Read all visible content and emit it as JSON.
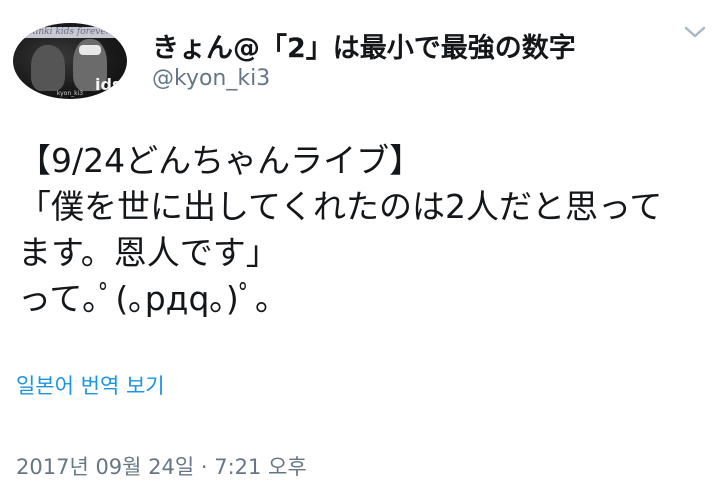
{
  "author": {
    "display_name": "きょん@「2」は最小で最強の数字",
    "handle": "@kyon_ki3",
    "avatar": {
      "banner_text": "kinki kids forever",
      "overlay_text": "ids",
      "caption": "kyon_ki3"
    }
  },
  "menu": {
    "icon": "chevron-down-icon"
  },
  "tweet": {
    "lines": [
      "【9/24どんちゃんライブ】",
      "「僕を世に出してくれたのは2人だと思って",
      "ます。恩人です」",
      "って｡ﾟ(｡pдq｡)ﾟ｡"
    ]
  },
  "translate_link": "일본어 번역 보기",
  "timestamp": "2017년 09월 24일 · 7:21 오후",
  "colors": {
    "link": "#1b95e0",
    "secondary_text": "#657786",
    "primary_text": "#14171a"
  }
}
